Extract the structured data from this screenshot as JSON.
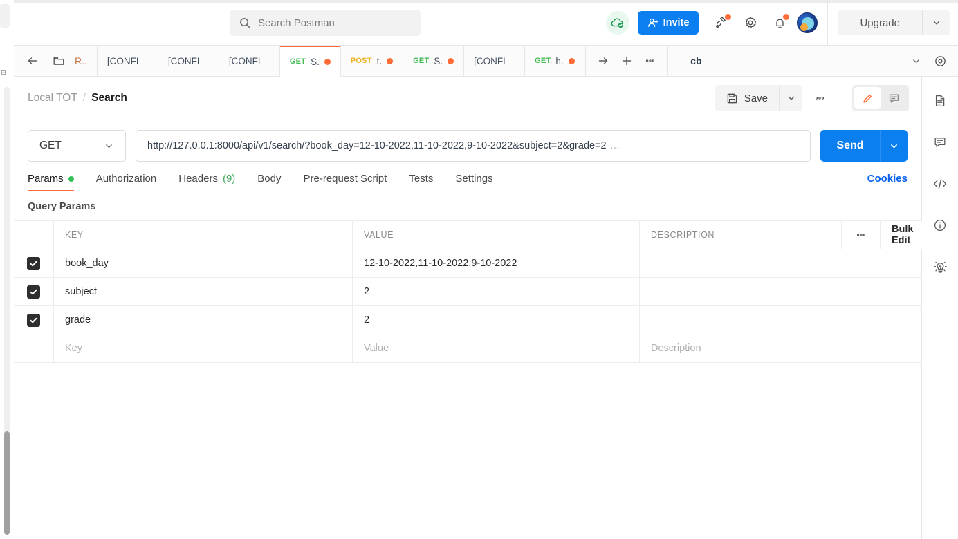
{
  "topbar": {
    "search": {
      "placeholder": "Search Postman",
      "icon": "search-icon"
    },
    "cloud_icon": "cloud-check-icon",
    "invite_label": "Invite",
    "invite_icon": "user-plus-icon",
    "satellite_icon": "satellite-icon",
    "settings_icon": "gear-icon",
    "notifications_icon": "bell-icon",
    "avatar_icon": "user-avatar-icon",
    "upgrade_label": "Upgrade",
    "upgrade_caret_icon": "chevron-down-icon",
    "accent_blue": "#0b7ff0",
    "accent_orange": "#ff6c37"
  },
  "tabstrip": {
    "back_icon": "arrow-left-icon",
    "folder_icon": "folder-icon",
    "collection_label": "R..",
    "tabs": [
      {
        "method": "",
        "name": "[CONFL",
        "dirty": false,
        "active": false
      },
      {
        "method": "",
        "name": "[CONFL",
        "dirty": false,
        "active": false
      },
      {
        "method": "",
        "name": "[CONFL",
        "dirty": false,
        "active": false
      },
      {
        "method": "GET",
        "name": "S.",
        "dirty": true,
        "active": true
      },
      {
        "method": "POST",
        "name": "t.",
        "dirty": true,
        "active": false
      },
      {
        "method": "GET",
        "name": "S.",
        "dirty": true,
        "active": false
      },
      {
        "method": "",
        "name": "[CONFL",
        "dirty": false,
        "active": false
      },
      {
        "method": "GET",
        "name": "h.",
        "dirty": true,
        "active": false
      }
    ],
    "forward_icon": "arrow-right-icon",
    "new_tab_icon": "plus-icon",
    "tab_more_icon": "ellipsis-icon",
    "environment": "cb",
    "env_caret_icon": "chevron-down-icon",
    "env_eye_icon": "eye-icon"
  },
  "request": {
    "breadcrumb": {
      "parent": "Local TOT",
      "separator": "/",
      "current": "Search"
    },
    "save_label": "Save",
    "save_icon": "floppy-disk-icon",
    "save_caret_icon": "chevron-down-icon",
    "more_icon": "ellipsis-icon",
    "edit_icon": "pencil-icon",
    "comment_icon": "comment-icon",
    "method": "GET",
    "method_caret_icon": "chevron-down-icon",
    "url": "http://127.0.0.1:8000/api/v1/search/?book_day=12-10-2022,11-10-2022,9-10-2022&subject=2&grade=2",
    "url_ellipsis": "…",
    "send_label": "Send",
    "send_caret_icon": "chevron-down-icon",
    "subtabs": [
      {
        "label": "Params",
        "badge": "dot",
        "active": true
      },
      {
        "label": "Authorization",
        "badge": "",
        "active": false
      },
      {
        "label": "Headers",
        "badge": "(9)",
        "active": false
      },
      {
        "label": "Body",
        "badge": "",
        "active": false
      },
      {
        "label": "Pre-request Script",
        "badge": "",
        "active": false
      },
      {
        "label": "Tests",
        "badge": "",
        "active": false
      },
      {
        "label": "Settings",
        "badge": "",
        "active": false
      }
    ],
    "cookies_label": "Cookies"
  },
  "query_params": {
    "section_title": "Query Params",
    "columns": {
      "key": "KEY",
      "value": "VALUE",
      "description": "DESCRIPTION"
    },
    "column_more_icon": "ellipsis-icon",
    "bulk_edit_label": "Bulk Edit",
    "rows": [
      {
        "checked": true,
        "key": "book_day",
        "value": "12-10-2022,11-10-2022,9-10-2022",
        "description": ""
      },
      {
        "checked": true,
        "key": "subject",
        "value": "2",
        "description": ""
      },
      {
        "checked": true,
        "key": "grade",
        "value": "2",
        "description": ""
      }
    ],
    "placeholder_row": {
      "key": "Key",
      "value": "Value",
      "description": "Description"
    }
  },
  "right_rail": [
    {
      "icon": "document-icon",
      "name": "documentation"
    },
    {
      "icon": "comment-icon",
      "name": "comments"
    },
    {
      "icon": "code-icon",
      "name": "code-snippet"
    },
    {
      "icon": "info-circle-icon",
      "name": "info"
    },
    {
      "icon": "lightbulb-icon",
      "name": "tips"
    }
  ]
}
